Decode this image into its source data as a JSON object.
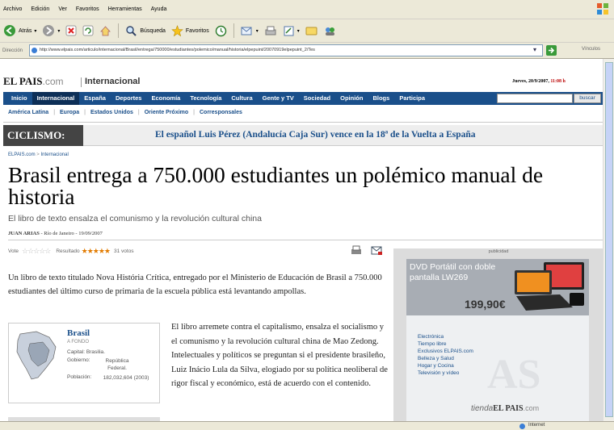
{
  "menu": [
    "Archivo",
    "Edición",
    "Ver",
    "Favoritos",
    "Herramientas",
    "Ayuda"
  ],
  "toolbar": {
    "back": "Atrás",
    "search": "Búsqueda",
    "favorites": "Favoritos"
  },
  "address": {
    "label": "Dirección",
    "url": "http://www.elpais.com/articulo/internacional/Brasil/entrega/750000/estudiantes/polemico/manual/historia/elpepuint/20070919elpepuint_2/Tes",
    "links": "Vínculos"
  },
  "site": {
    "logo_el": "EL PAIS",
    "logo_com": ".com",
    "section": "Internacional",
    "date": "Jueves, 20/9/2007,",
    "time": "11:08 h"
  },
  "nav": [
    "Inicio",
    "Internacional",
    "España",
    "Deportes",
    "Economía",
    "Tecnología",
    "Cultura",
    "Gente y TV",
    "Sociedad",
    "Opinión",
    "Blogs",
    "Participa"
  ],
  "search_button": "buscar",
  "subnav": [
    "América Latina",
    "Europa",
    "Estados Unidos",
    "Oriente Próximo",
    "Corresponsales"
  ],
  "flash": {
    "label": "CICLISMO:",
    "text": "El español Luis Pérez (Andalucía Caja Sur) vence en la 18ª de la Vuelta a España"
  },
  "breadcrumb": {
    "home": "ELPAIS.com",
    "sep": ">",
    "section": "Internacional"
  },
  "article": {
    "title": "Brasil entrega a 750.000 estudiantes un polémico manual de historia",
    "subtitle": "El libro de texto ensalza el comunismo y la revolución cultural china",
    "author": "JUAN ARIAS",
    "dateline": "- Río de Janeiro - 19/09/2007",
    "vote_label": "Vote",
    "rating_label": "Resultado",
    "votes": "31 votos",
    "lead": "Un libro de texto titulado Nova História Crítica, entregado por el Ministerio de Educación de Brasil a 750.000 estudiantes del último curso de primaria de la escuela pública está levantando ampollas.",
    "body": "El libro arremete contra el capitalismo, ensalza el socialismo y el comunismo y la revolución cultural china de Mao Zedong. Intelectuales y políticos se preguntan si el presidente brasileño, Luiz Inácio Lula da Silva, elogiado por su política neoliberal de rigor fiscal y económico, está de acuerdo con el contenido."
  },
  "country": {
    "name": "Brasil",
    "subtitle": "A FONDO",
    "capital_label": "Capital:",
    "capital": "Brasilia.",
    "gov_label": "Gobierno:",
    "gov": "República Federal.",
    "pop_label": "Población:",
    "pop": "182,032,604 (2003)"
  },
  "ad": {
    "tag": "publicidad",
    "title": "DVD Portátil con doble pantalla LW269",
    "price": "199,90€",
    "items": [
      "Electrónica",
      "Tiempo libre",
      "Exclusivos ELPAIS.com",
      "Belleza y Salud",
      "Hogar y Cocina",
      "Televisión y vídeo"
    ],
    "store_tienda": "tienda",
    "store_brand": "EL PAIS",
    "store_com": ".com"
  },
  "status": {
    "zone": "Internet"
  }
}
